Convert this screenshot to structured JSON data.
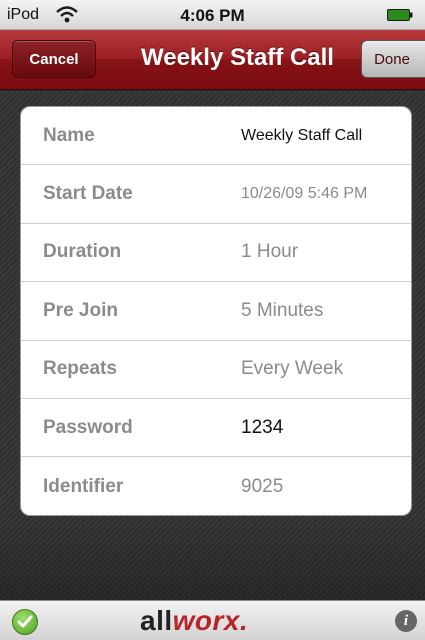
{
  "status_bar": {
    "carrier": "iPod",
    "wifi_icon": "wifi-icon",
    "time": "4:06 PM",
    "battery_icon": "battery-icon"
  },
  "nav": {
    "cancel_label": "Cancel",
    "title": "Weekly Staff Call",
    "done_label": "Done"
  },
  "details": [
    {
      "label": "Name",
      "value": "Weekly Staff Call"
    },
    {
      "label": "Start Date",
      "value": "10/26/09 5:46 PM"
    },
    {
      "label": "Duration",
      "value": "1 Hour"
    },
    {
      "label": "Pre Join",
      "value": "5 Minutes"
    },
    {
      "label": "Repeats",
      "value": "Every Week"
    },
    {
      "label": "Password",
      "value": "1234"
    },
    {
      "label": "Identifier",
      "value": "9025"
    }
  ],
  "footer": {
    "logo_text_a": "all",
    "logo_text_b": "worx",
    "logo_text_c": ".",
    "status_icon": "check-icon",
    "info_icon": "info-icon",
    "info_glyph": "i"
  },
  "colors": {
    "nav_red": "#8e1a1e",
    "brand_red": "#b5262b",
    "label_gray": "#8b8b8b"
  }
}
